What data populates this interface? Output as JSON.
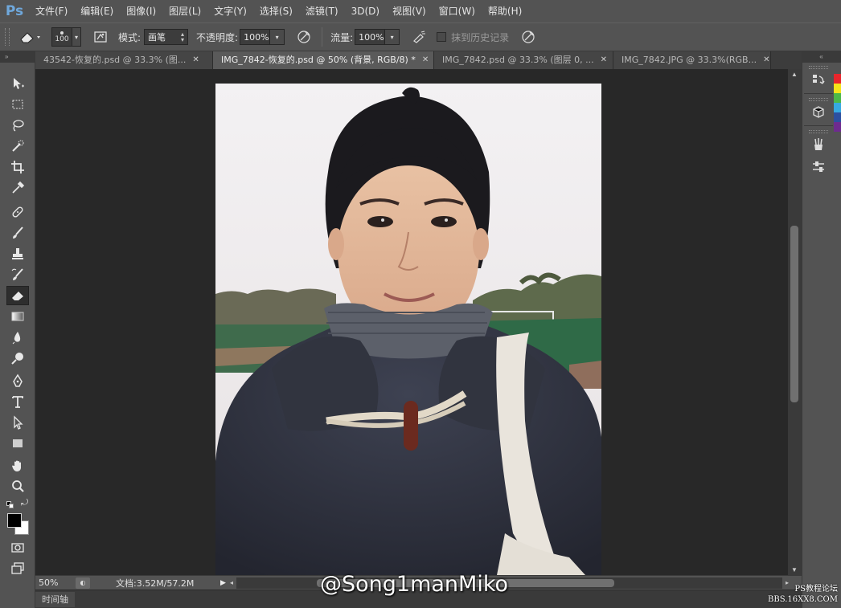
{
  "app": {
    "logo": "Ps"
  },
  "menu": [
    "文件(F)",
    "编辑(E)",
    "图像(I)",
    "图层(L)",
    "文字(Y)",
    "选择(S)",
    "滤镜(T)",
    "3D(D)",
    "视图(V)",
    "窗口(W)",
    "帮助(H)"
  ],
  "options": {
    "brush_size": "100",
    "mode_label": "模式:",
    "mode_value": "画笔",
    "opacity_label": "不透明度:",
    "opacity_value": "100%",
    "flow_label": "流量:",
    "flow_value": "100%",
    "erase_history_label": "抹到历史记录"
  },
  "tabs": [
    {
      "label": "43542-恢复的.psd @ 33.3% (图...",
      "active": false
    },
    {
      "label": "IMG_7842-恢复的.psd @ 50% (背景, RGB/8) *",
      "active": true
    },
    {
      "label": "IMG_7842.psd @ 33.3% (图层 0, ...",
      "active": false
    },
    {
      "label": "IMG_7842.JPG @ 33.3%(RGB...",
      "active": false
    }
  ],
  "status": {
    "zoom": "50%",
    "doc_info": "文档:3.52M/57.2M"
  },
  "timeline_tab": "时间轴",
  "watermark": "@Song1manMiko",
  "corner_watermark": {
    "line1": "PS教程论坛",
    "line2": "BBS.16XX8.COM"
  },
  "colors": {
    "ui_bg": "#535353",
    "canvas_bg": "#282828",
    "foreground": "#000000",
    "background": "#ffffff",
    "swatches": [
      "#e8252c",
      "#f5e31a",
      "#4cb848",
      "#36a9e1",
      "#2c4fa0",
      "#6e2b8f"
    ]
  },
  "tools": [
    "move-tool",
    "marquee-tool",
    "lasso-tool",
    "quick-select-tool",
    "crop-tool",
    "eyedropper-tool",
    "healing-brush-tool",
    "brush-tool",
    "clone-stamp-tool",
    "history-brush-tool",
    "eraser-tool",
    "gradient-tool",
    "blur-tool",
    "dodge-tool",
    "pen-tool",
    "type-tool",
    "path-select-tool",
    "rectangle-tool",
    "hand-tool",
    "zoom-tool"
  ],
  "active_tool": "eraser-tool"
}
